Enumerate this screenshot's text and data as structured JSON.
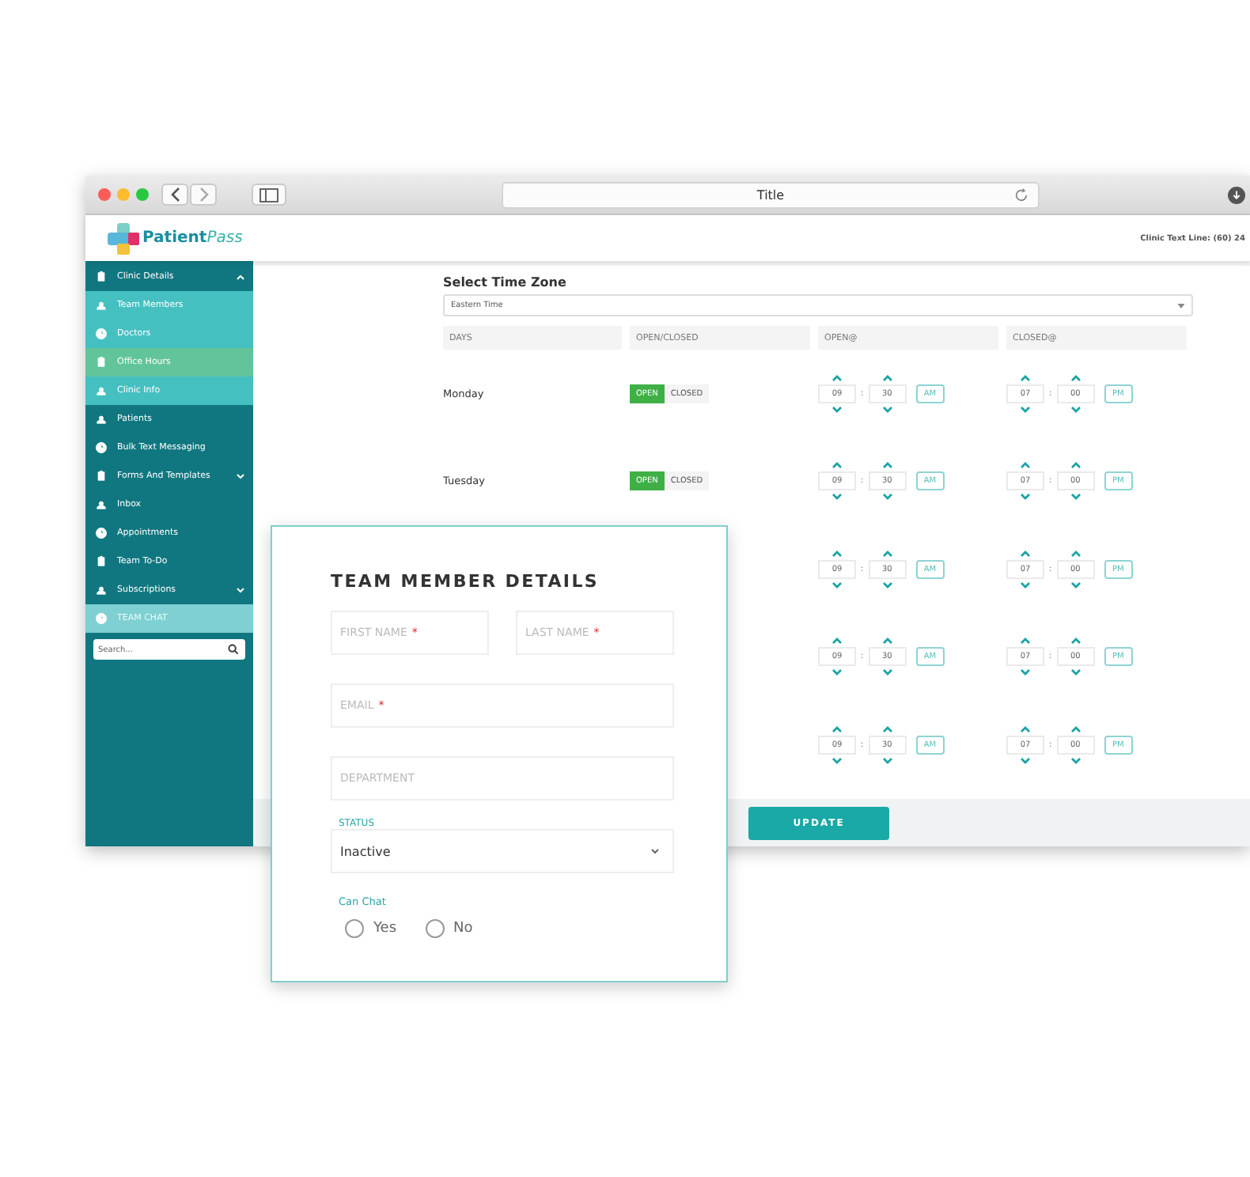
{
  "browser": {
    "title": "Title"
  },
  "header": {
    "logo_left": "Patient",
    "logo_right": "Pass",
    "clinic_line": "Clinic Text Line: (60) 24"
  },
  "sidebar": {
    "items": [
      {
        "label": "Clinic Details",
        "kind": "parent",
        "selected": false,
        "expanded": true,
        "children": [
          {
            "label": "Team Members",
            "selected": false
          },
          {
            "label": "Doctors",
            "selected": false
          },
          {
            "label": "Office Hours",
            "selected": true
          },
          {
            "label": "Clinic Info",
            "selected": false
          }
        ]
      },
      {
        "label": "Patients",
        "kind": "parent",
        "selected": false
      },
      {
        "label": "Bulk Text Messaging",
        "kind": "parent",
        "selected": false
      },
      {
        "label": "Forms And Templates",
        "kind": "parent",
        "selected": false,
        "expanded": false
      },
      {
        "label": "Inbox",
        "kind": "parent",
        "selected": false
      },
      {
        "label": "Appointments",
        "kind": "parent",
        "selected": false
      },
      {
        "label": "Team To-Do",
        "kind": "parent",
        "selected": false
      },
      {
        "label": "Subscriptions",
        "kind": "parent",
        "selected": false,
        "expanded": false
      },
      {
        "label": "TEAM CHAT",
        "kind": "chat",
        "selected": false
      }
    ],
    "search": {
      "placeholder": "Search..."
    }
  },
  "hours": {
    "timezone_label": "Select Time Zone",
    "timezone": "Eastern Time",
    "columns": [
      "DAYS",
      "OPEN/CLOSED",
      "OPEN@",
      "CLOSED@"
    ],
    "rows": [
      {
        "day": "Monday",
        "toggle": [
          {
            "label": "OPEN",
            "selected": true
          },
          {
            "label": "CLOSED",
            "selected": false
          }
        ],
        "open": {
          "hour": "09",
          "sep": ":",
          "minute": "30",
          "meridiem": "AM"
        },
        "close": {
          "hour": "07",
          "sep": ":",
          "minute": "00",
          "meridiem": "PM"
        }
      },
      {
        "day": "Tuesday",
        "toggle": [
          {
            "label": "OPEN",
            "selected": true
          },
          {
            "label": "CLOSED",
            "selected": false
          }
        ],
        "open": {
          "hour": "09",
          "sep": ":",
          "minute": "30",
          "meridiem": "AM"
        },
        "close": {
          "hour": "07",
          "sep": ":",
          "minute": "00",
          "meridiem": "PM"
        }
      },
      {
        "open": {
          "hour": "09",
          "sep": ":",
          "minute": "30",
          "meridiem": "AM"
        },
        "close": {
          "hour": "07",
          "sep": ":",
          "minute": "00",
          "meridiem": "PM"
        }
      },
      {
        "open": {
          "hour": "09",
          "sep": ":",
          "minute": "30",
          "meridiem": "AM"
        },
        "close": {
          "hour": "07",
          "sep": ":",
          "minute": "00",
          "meridiem": "PM"
        }
      },
      {
        "open": {
          "hour": "09",
          "sep": ":",
          "minute": "30",
          "meridiem": "AM"
        },
        "close": {
          "hour": "07",
          "sep": ":",
          "minute": "00",
          "meridiem": "PM"
        }
      }
    ],
    "update_button": "UPDATE"
  },
  "modal": {
    "title": "TEAM MEMBER DETAILS",
    "fields": [
      {
        "placeholder": "FIRST NAME",
        "mark": "*",
        "kind": "half"
      },
      {
        "placeholder": "LAST NAME",
        "mark": "*",
        "kind": "half"
      },
      {
        "placeholder": "EMAIL",
        "mark": "*",
        "kind": "full"
      },
      {
        "placeholder": "DEPARTMENT",
        "kind": "full"
      }
    ],
    "status": {
      "label": "STATUS",
      "value": "Inactive"
    },
    "can_chat": {
      "label": "Can Chat",
      "options": [
        {
          "label": "Yes",
          "selected": false
        },
        {
          "label": "No",
          "selected": false
        }
      ]
    }
  }
}
